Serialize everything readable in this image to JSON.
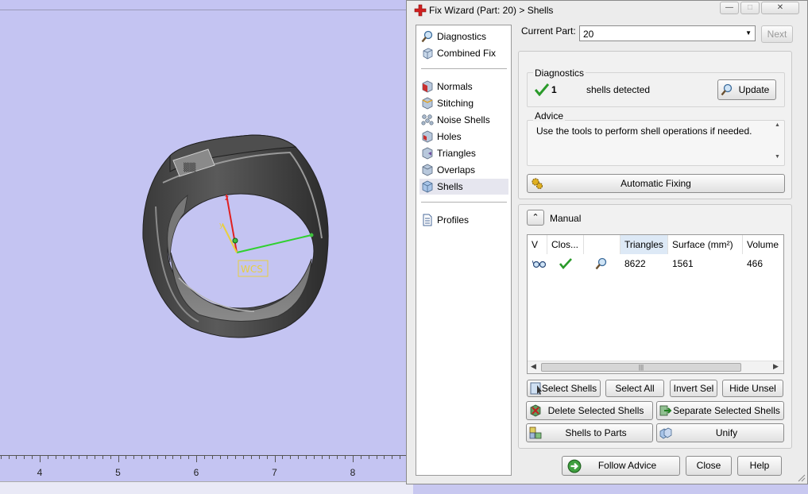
{
  "viewport": {
    "ruler_labels": [
      "4",
      "5",
      "6",
      "7",
      "8"
    ],
    "wcs_label": "WCS"
  },
  "window": {
    "title": "Fix Wizard (Part: 20) > Shells",
    "caption_minimize": "—",
    "caption_maximize": "□",
    "caption_close": "✕"
  },
  "nav": {
    "group1": [
      {
        "label": "Diagnostics",
        "icon": "magnifier-icon"
      },
      {
        "label": "Combined Fix",
        "icon": "cube-stack-icon"
      }
    ],
    "group2": [
      {
        "label": "Normals",
        "icon": "normals-cube-icon"
      },
      {
        "label": "Stitching",
        "icon": "stitching-cube-icon"
      },
      {
        "label": "Noise Shells",
        "icon": "noise-shells-icon"
      },
      {
        "label": "Holes",
        "icon": "holes-cube-icon"
      },
      {
        "label": "Triangles",
        "icon": "triangles-cube-icon"
      },
      {
        "label": "Overlaps",
        "icon": "overlaps-cube-icon"
      },
      {
        "label": "Shells",
        "icon": "shells-cube-icon",
        "selected": true
      }
    ],
    "group3": [
      {
        "label": "Profiles",
        "icon": "document-icon"
      }
    ]
  },
  "current_part": {
    "label": "Current Part:",
    "value": "20",
    "next_label": "Next"
  },
  "diagnostics": {
    "title": "Diagnostics",
    "count": "1",
    "text": "shells detected",
    "update_label": "Update"
  },
  "advice": {
    "title": "Advice",
    "text": "Use the tools to perform shell operations if needed."
  },
  "automatic_fixing_label": "Automatic Fixing",
  "manual": {
    "title": "Manual",
    "columns": [
      "V",
      "Clos...",
      "",
      "Triangles",
      "Surface (mm²)",
      "Volume"
    ],
    "rows": [
      {
        "triangles": "8622",
        "surface": "1561",
        "volume": "466"
      }
    ]
  },
  "buttons": {
    "select_shells": "Select Shells",
    "select_all": "Select All",
    "invert_sel": "Invert Sel",
    "hide_unsel": "Hide Unsel",
    "delete_selected": "Delete Selected Shells",
    "separate_selected": "Separate Selected Shells",
    "shells_to_parts": "Shells to Parts",
    "unify": "Unify",
    "follow_advice": "Follow Advice",
    "close": "Close",
    "help": "Help"
  },
  "colors": {
    "viewport_bg": "#c4c4f2",
    "check_green": "#2a9a2a",
    "axis_red": "#e02020",
    "axis_green": "#30d030",
    "axis_yellow": "#e8d040"
  }
}
